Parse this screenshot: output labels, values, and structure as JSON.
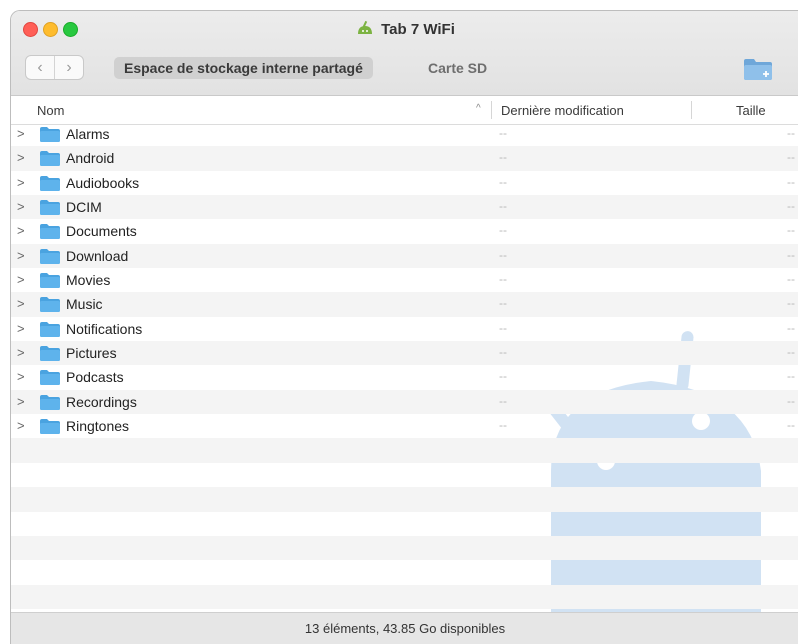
{
  "window": {
    "title": "Tab 7 WiFi"
  },
  "toolbar": {
    "back_glyph": "‹",
    "forward_glyph": "›",
    "tabs": [
      {
        "label": "Espace de stockage interne partagé",
        "active": true
      },
      {
        "label": "Carte SD",
        "active": false
      }
    ],
    "new_folder_icon": "new-folder-icon"
  },
  "columns": {
    "name": "Nom",
    "sort_indicator": "^",
    "date": "Dernière modification",
    "size": "Taille"
  },
  "rows": [
    {
      "name": "Alarms",
      "date": "--",
      "size": "--"
    },
    {
      "name": "Android",
      "date": "--",
      "size": "--"
    },
    {
      "name": "Audiobooks",
      "date": "--",
      "size": "--"
    },
    {
      "name": "DCIM",
      "date": "--",
      "size": "--"
    },
    {
      "name": "Documents",
      "date": "--",
      "size": "--"
    },
    {
      "name": "Download",
      "date": "--",
      "size": "--"
    },
    {
      "name": "Movies",
      "date": "--",
      "size": "--"
    },
    {
      "name": "Music",
      "date": "--",
      "size": "--"
    },
    {
      "name": "Notifications",
      "date": "--",
      "size": "--"
    },
    {
      "name": "Pictures",
      "date": "--",
      "size": "--"
    },
    {
      "name": "Podcasts",
      "date": "--",
      "size": "--"
    },
    {
      "name": "Recordings",
      "date": "--",
      "size": "--"
    },
    {
      "name": "Ringtones",
      "date": "--",
      "size": "--"
    }
  ],
  "empty_rows": 7,
  "status": {
    "text": "13 éléments, 43.85 Go disponibles"
  },
  "colors": {
    "folder": "#4aa3e0",
    "android_watermark": "#c9ddf1"
  }
}
